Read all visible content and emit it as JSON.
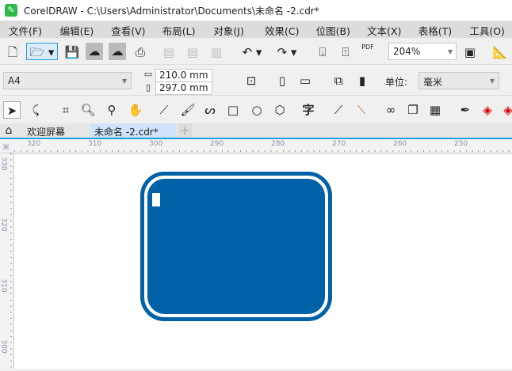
{
  "title": "CorelDRAW - C:\\Users\\Administrator\\Documents\\未命名 -2.cdr*",
  "menu": [
    "文件(F)",
    "编辑(E)",
    "查看(V)",
    "布局(L)",
    "对象(J)",
    "效果(C)",
    "位图(B)",
    "文本(X)",
    "表格(T)",
    "工具(O)"
  ],
  "toolbar": {
    "zoom": "204%",
    "pdf_label": "PDF"
  },
  "property_bar": {
    "page_size": "A4",
    "width": "210.0 mm",
    "height": "297.0 mm",
    "unit_label": "单位:",
    "unit": "毫米"
  },
  "toolbox": {
    "text_tool": "字"
  },
  "tabs": [
    {
      "label": "欢迎屏幕"
    },
    {
      "label": "未命名 -2.cdr*",
      "active": true
    }
  ],
  "rulers": {
    "horizontal": [
      "320",
      "310",
      "300",
      "290",
      "280",
      "270",
      "260",
      "250"
    ],
    "vertical": [
      "330",
      "320",
      "310",
      "300"
    ],
    "corner": "米"
  },
  "colors": {
    "accent": "#1ea0e6",
    "shape": "#0061a6"
  }
}
